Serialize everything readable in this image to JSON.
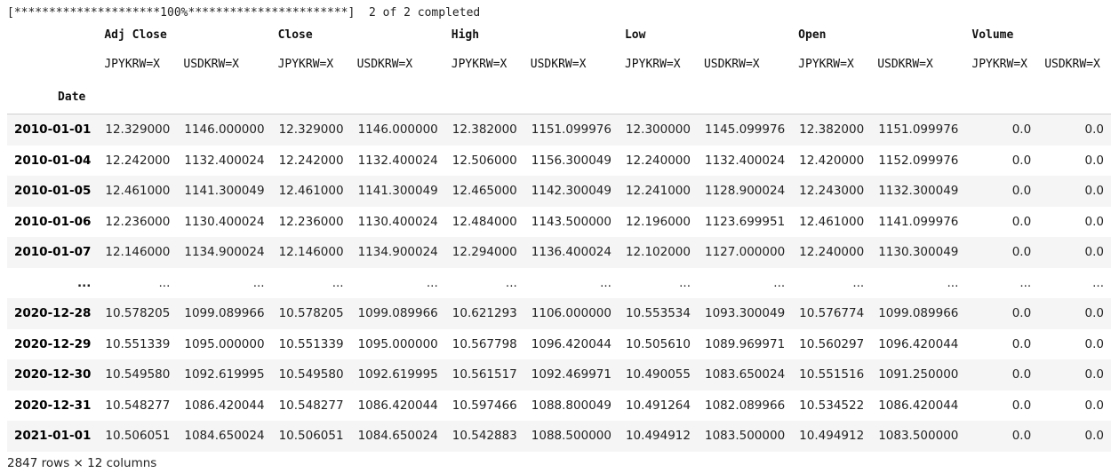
{
  "progress": {
    "bar": "[*********************100%***********************]",
    "status": "  2 of 2 completed"
  },
  "dataframe": {
    "index_name": "Date",
    "groups": [
      "Adj Close",
      "Close",
      "High",
      "Low",
      "Open",
      "Volume"
    ],
    "tickers": [
      "JPYKRW=X",
      "USDKRW=X",
      "JPYKRW=X",
      "USDKRW=X",
      "JPYKRW=X",
      "USDKRW=X",
      "JPYKRW=X",
      "USDKRW=X",
      "JPYKRW=X",
      "USDKRW=X",
      "JPYKRW=X",
      "USDKRW=X"
    ],
    "rows": [
      {
        "date": "2010-01-01",
        "cells": [
          "12.329000",
          "1146.000000",
          "12.329000",
          "1146.000000",
          "12.382000",
          "1151.099976",
          "12.300000",
          "1145.099976",
          "12.382000",
          "1151.099976",
          "0.0",
          "0.0"
        ]
      },
      {
        "date": "2010-01-04",
        "cells": [
          "12.242000",
          "1132.400024",
          "12.242000",
          "1132.400024",
          "12.506000",
          "1156.300049",
          "12.240000",
          "1132.400024",
          "12.420000",
          "1152.099976",
          "0.0",
          "0.0"
        ]
      },
      {
        "date": "2010-01-05",
        "cells": [
          "12.461000",
          "1141.300049",
          "12.461000",
          "1141.300049",
          "12.465000",
          "1142.300049",
          "12.241000",
          "1128.900024",
          "12.243000",
          "1132.300049",
          "0.0",
          "0.0"
        ]
      },
      {
        "date": "2010-01-06",
        "cells": [
          "12.236000",
          "1130.400024",
          "12.236000",
          "1130.400024",
          "12.484000",
          "1143.500000",
          "12.196000",
          "1123.699951",
          "12.461000",
          "1141.099976",
          "0.0",
          "0.0"
        ]
      },
      {
        "date": "2010-01-07",
        "cells": [
          "12.146000",
          "1134.900024",
          "12.146000",
          "1134.900024",
          "12.294000",
          "1136.400024",
          "12.102000",
          "1127.000000",
          "12.240000",
          "1130.300049",
          "0.0",
          "0.0"
        ]
      },
      {
        "date": "...",
        "cells": [
          "...",
          "...",
          "...",
          "...",
          "...",
          "...",
          "...",
          "...",
          "...",
          "...",
          "...",
          "..."
        ]
      },
      {
        "date": "2020-12-28",
        "cells": [
          "10.578205",
          "1099.089966",
          "10.578205",
          "1099.089966",
          "10.621293",
          "1106.000000",
          "10.553534",
          "1093.300049",
          "10.576774",
          "1099.089966",
          "0.0",
          "0.0"
        ]
      },
      {
        "date": "2020-12-29",
        "cells": [
          "10.551339",
          "1095.000000",
          "10.551339",
          "1095.000000",
          "10.567798",
          "1096.420044",
          "10.505610",
          "1089.969971",
          "10.560297",
          "1096.420044",
          "0.0",
          "0.0"
        ]
      },
      {
        "date": "2020-12-30",
        "cells": [
          "10.549580",
          "1092.619995",
          "10.549580",
          "1092.619995",
          "10.561517",
          "1092.469971",
          "10.490055",
          "1083.650024",
          "10.551516",
          "1091.250000",
          "0.0",
          "0.0"
        ]
      },
      {
        "date": "2020-12-31",
        "cells": [
          "10.548277",
          "1086.420044",
          "10.548277",
          "1086.420044",
          "10.597466",
          "1088.800049",
          "10.491264",
          "1082.089966",
          "10.534522",
          "1086.420044",
          "0.0",
          "0.0"
        ]
      },
      {
        "date": "2021-01-01",
        "cells": [
          "10.506051",
          "1084.650024",
          "10.506051",
          "1084.650024",
          "10.542883",
          "1088.500000",
          "10.494912",
          "1083.500000",
          "10.494912",
          "1083.500000",
          "0.0",
          "0.0"
        ]
      }
    ],
    "shape_text": "2847 rows × 12 columns"
  }
}
